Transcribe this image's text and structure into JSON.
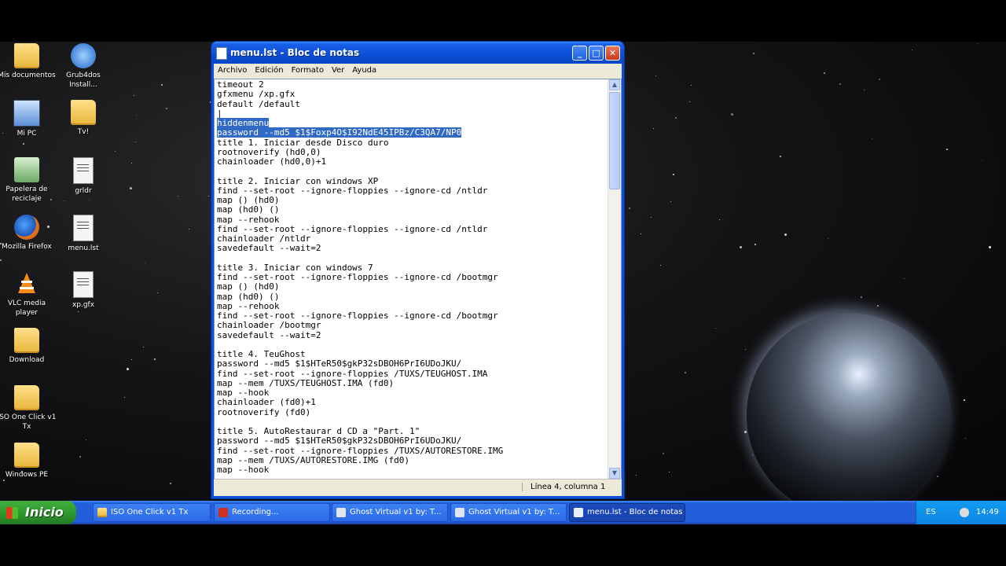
{
  "desktop": {
    "icons": [
      {
        "label": "Mis documentos"
      },
      {
        "label": "Grub4dos Install..."
      },
      {
        "label": "Mi PC"
      },
      {
        "label": "Tv!"
      },
      {
        "label": "Papelera de reciclaje"
      },
      {
        "label": "grldr"
      },
      {
        "label": "Mozilla Firefox"
      },
      {
        "label": "menu.lst"
      },
      {
        "label": "VLC media player"
      },
      {
        "label": "xp.gfx"
      },
      {
        "label": "Download"
      },
      {
        "label": "ISO One Click v1 Tx"
      },
      {
        "label": "Windows PE"
      }
    ]
  },
  "window": {
    "title": "menu.lst - Bloc de notas",
    "controls": {
      "minimize": "_",
      "maximize": "□",
      "close": "✕"
    },
    "menu": [
      "Archivo",
      "Edición",
      "Formato",
      "Ver",
      "Ayuda"
    ],
    "lines": [
      "timeout 2",
      "gfxmenu /xp.gfx",
      "default /default",
      "",
      "hiddenmenu",
      "password --md5 $1$Foxp4O$I92NdE45IPBz/C3QA7/NP0",
      "title 1. Iniciar desde Disco duro",
      "rootnoverify (hd0,0)",
      "chainloader (hd0,0)+1",
      "",
      "title 2. Iniciar con windows XP",
      "find --set-root --ignore-floppies --ignore-cd /ntldr",
      "map () (hd0)",
      "map (hd0) ()",
      "map --rehook",
      "find --set-root --ignore-floppies --ignore-cd /ntldr",
      "chainloader /ntldr",
      "savedefault --wait=2",
      "",
      "title 3. Iniciar con windows 7",
      "find --set-root --ignore-floppies --ignore-cd /bootmgr",
      "map () (hd0)",
      "map (hd0) ()",
      "map --rehook",
      "find --set-root --ignore-floppies --ignore-cd /bootmgr",
      "chainloader /bootmgr",
      "savedefault --wait=2",
      "",
      "title 4. TeuGhost",
      "password --md5 $1$HTeR50$gkP32sDBOH6PrI6UDoJKU/",
      "find --set-root --ignore-floppies /TUXS/TEUGHOST.IMA",
      "map --mem /TUXS/TEUGHOST.IMA (fd0)",
      "map --hook",
      "chainloader (fd0)+1",
      "rootnoverify (fd0)",
      "",
      "title 5. AutoRestaurar d CD a \"Part. 1\"",
      "password --md5 $1$HTeR50$gkP32sDBOH6PrI6UDoJKU/",
      "find --set-root --ignore-floppies /TUXS/AUTORESTORE.IMG",
      "map --mem /TUXS/AUTORESTORE.IMG (fd0)",
      "map --hook"
    ],
    "selected_lines": [
      4,
      5
    ],
    "status": "Línea 4, columna 1"
  },
  "taskbar": {
    "start_label": "Inicio",
    "buttons": [
      {
        "label": "ISO One Click v1 Tx",
        "active": false
      },
      {
        "label": "Recording...",
        "active": false
      },
      {
        "label": "Ghost Virtual v1 by: T...",
        "active": false
      },
      {
        "label": "Ghost Virtual v1 by: T...",
        "active": false
      },
      {
        "label": "menu.lst - Bloc de notas",
        "active": true
      }
    ],
    "tray": {
      "lang": "ES",
      "time": "14:49"
    }
  },
  "colors": {
    "selection": "#316ac5",
    "titlebar": "#0a4fd6",
    "taskbar": "#245edb",
    "start": "#2f9b2f"
  }
}
